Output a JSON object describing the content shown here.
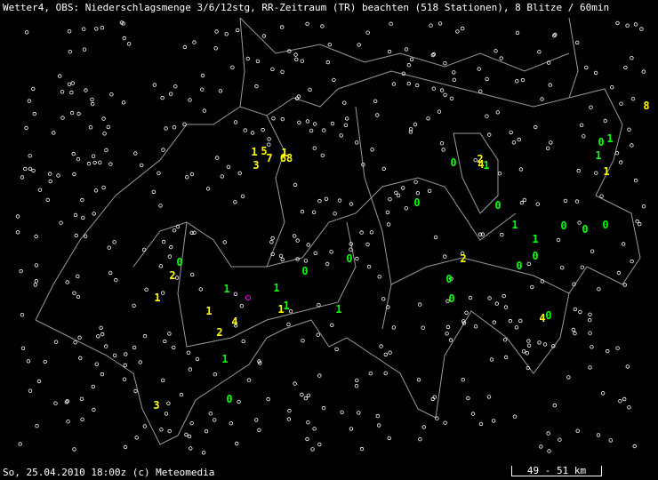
{
  "header": {
    "title": "Wetter4, OBS: Niederschlagsmenge 3/6/12stg, RR-Zeitraum (TR) beachten (518 Stationen), 8 Blitze / 60min"
  },
  "footer": {
    "timestamp": "So, 25.04.2010 18:00z (c) Meteomedia",
    "scale_label": "49 - 51 km"
  },
  "colors": {
    "background": "#000000",
    "border": "#9a9a9a",
    "station": "#ffffff",
    "yellow": "#ffff00",
    "green": "#00ff00",
    "lightning": "#ff00ff"
  },
  "observations": [
    {
      "value": "1",
      "color": "yellow"
    },
    {
      "value": "5",
      "color": "yellow"
    },
    {
      "value": "3",
      "color": "yellow"
    },
    {
      "value": "7",
      "color": "yellow"
    },
    {
      "value": "1",
      "color": "yellow"
    },
    {
      "value": "68",
      "color": "yellow"
    },
    {
      "value": "2",
      "color": "yellow"
    },
    {
      "value": "4",
      "color": "yellow"
    },
    {
      "value": "8",
      "color": "yellow"
    },
    {
      "value": "1",
      "color": "yellow"
    },
    {
      "value": "2",
      "color": "yellow"
    },
    {
      "value": "1",
      "color": "yellow"
    },
    {
      "value": "1",
      "color": "yellow"
    },
    {
      "value": "4",
      "color": "yellow"
    },
    {
      "value": "2",
      "color": "yellow"
    },
    {
      "value": "1",
      "color": "yellow"
    },
    {
      "value": "2",
      "color": "yellow"
    },
    {
      "value": "4",
      "color": "yellow"
    },
    {
      "value": "3",
      "color": "yellow"
    },
    {
      "value": "0",
      "color": "green"
    },
    {
      "value": "1",
      "color": "green"
    },
    {
      "value": "1",
      "color": "green"
    },
    {
      "value": "0",
      "color": "green"
    },
    {
      "value": "1",
      "color": "green"
    },
    {
      "value": "0",
      "color": "green"
    },
    {
      "value": "0",
      "color": "green"
    },
    {
      "value": "1",
      "color": "green"
    },
    {
      "value": "1",
      "color": "green"
    },
    {
      "value": "0",
      "color": "green"
    },
    {
      "value": "0",
      "color": "green"
    },
    {
      "value": "0",
      "color": "green"
    },
    {
      "value": "0",
      "color": "green"
    },
    {
      "value": "0",
      "color": "green"
    },
    {
      "value": "0",
      "color": "green"
    },
    {
      "value": "1",
      "color": "green"
    },
    {
      "value": "1",
      "color": "green"
    },
    {
      "value": "1",
      "color": "green"
    },
    {
      "value": "1",
      "color": "green"
    },
    {
      "value": "0",
      "color": "green"
    },
    {
      "value": "0",
      "color": "green"
    },
    {
      "value": "0",
      "color": "green"
    },
    {
      "value": "0",
      "color": "green"
    },
    {
      "value": "0",
      "color": "green"
    },
    {
      "value": "1",
      "color": "green"
    },
    {
      "value": "0",
      "color": "green"
    }
  ]
}
